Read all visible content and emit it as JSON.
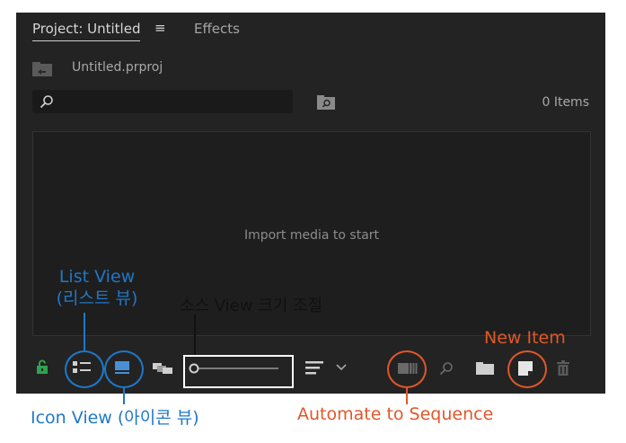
{
  "tabs": {
    "active": "Project: Untitled",
    "menu_glyph": "≡",
    "inactive": "Effects"
  },
  "project": {
    "file_name": "Untitled.prproj"
  },
  "search": {
    "placeholder": ""
  },
  "item_count": "0 Items",
  "content": {
    "empty_message": "Import media to start"
  },
  "toolbar": {
    "icons": [
      "lock-icon",
      "list-view-icon",
      "icon-view-icon",
      "freeform-view-icon",
      "zoom-slider",
      "sort-icon",
      "chevron-down-icon",
      "automate-to-sequence-icon",
      "find-icon",
      "new-bin-icon",
      "new-item-icon",
      "trash-icon"
    ]
  },
  "annotations": {
    "list_view_line1": "List View",
    "list_view_line2": "(리스트 뷰)",
    "slider_label": "소스 View 크기 조절",
    "new_item": "New Item",
    "icon_view": "Icon View (아이콘 뷰)",
    "automate": "Automate to Sequence"
  },
  "colors": {
    "panel_bg": "#232323",
    "annotation_blue": "#1f78c8",
    "annotation_orange": "#e0572a",
    "lock_green": "#2da44e"
  }
}
